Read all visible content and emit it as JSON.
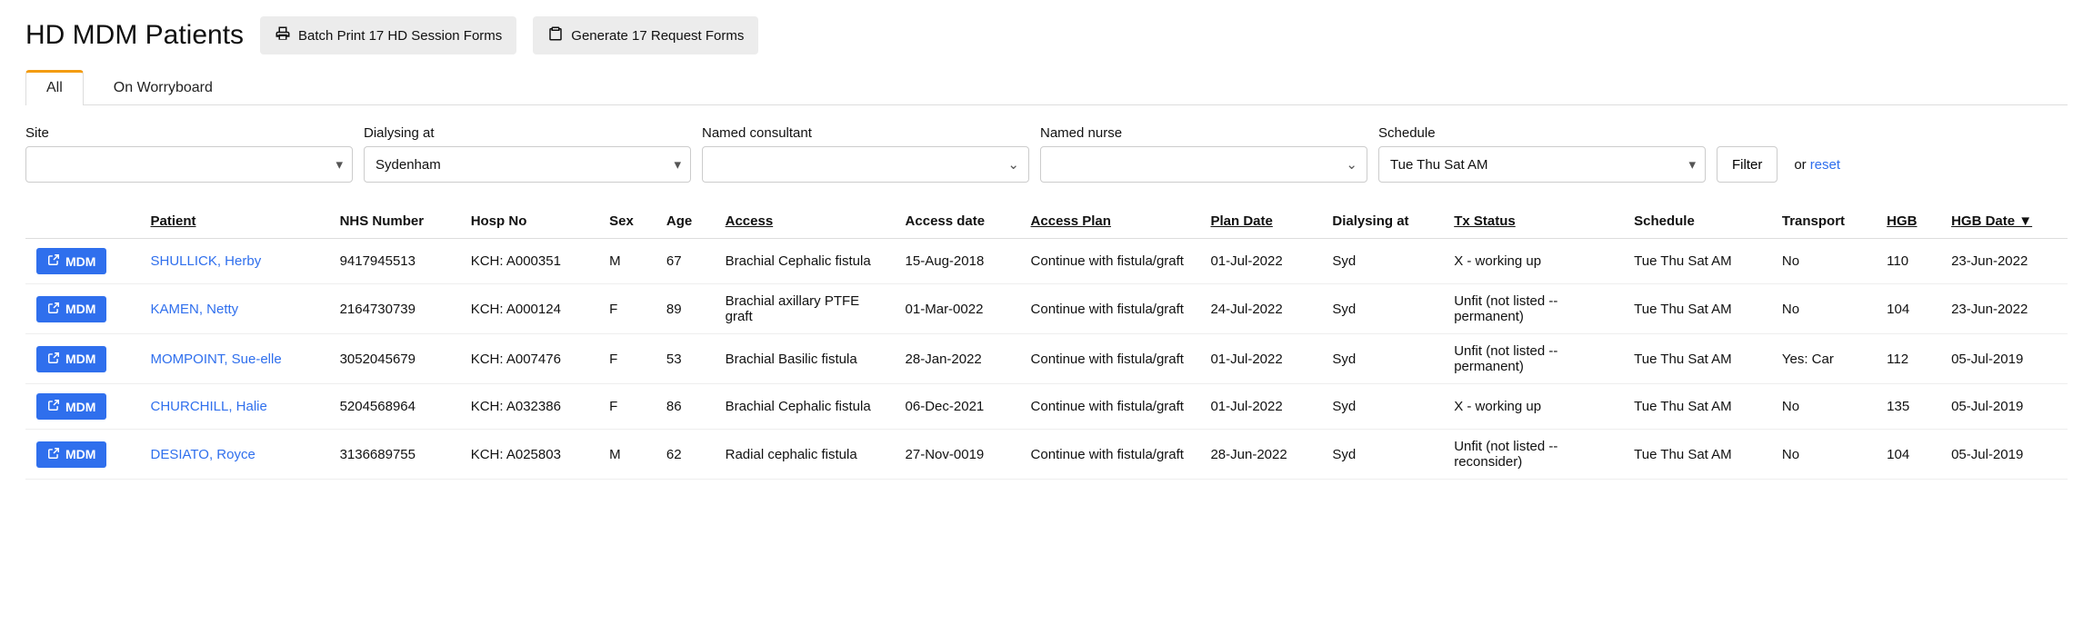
{
  "header": {
    "title": "HD MDM Patients",
    "batch_print_label": "Batch Print 17 HD Session Forms",
    "generate_label": "Generate 17 Request Forms"
  },
  "tabs": {
    "all": "All",
    "worry": "On Worryboard"
  },
  "filters": {
    "site_label": "Site",
    "site_value": "",
    "dialysing_label": "Dialysing at",
    "dialysing_value": "Sydenham",
    "consultant_label": "Named consultant",
    "consultant_value": "",
    "nurse_label": "Named nurse",
    "nurse_value": "",
    "schedule_label": "Schedule",
    "schedule_value": "Tue Thu Sat AM",
    "filter_button": "Filter",
    "or_text": "or",
    "reset_text": "reset"
  },
  "columns": {
    "mdm": "",
    "patient": "Patient",
    "nhs": "NHS Number",
    "hosp": "Hosp No",
    "sex": "Sex",
    "age": "Age",
    "access": "Access",
    "access_date": "Access date",
    "access_plan": "Access Plan",
    "plan_date": "Plan Date",
    "dialysing_at": "Dialysing at",
    "tx_status": "Tx Status",
    "schedule": "Schedule",
    "transport": "Transport",
    "hgb": "HGB",
    "hgb_date": "HGB Date ▼"
  },
  "mdm_button_label": "MDM",
  "rows": [
    {
      "patient": "SHULLICK, Herby",
      "nhs": "9417945513",
      "hosp": "KCH: A000351",
      "sex": "M",
      "age": "67",
      "access": "Brachial Cephalic fistula",
      "access_date": "15-Aug-2018",
      "access_plan": "Continue with fistula/graft",
      "plan_date": "01-Jul-2022",
      "dialysing_at": "Syd",
      "tx_status": "X - working up",
      "schedule": "Tue Thu Sat AM",
      "transport": "No",
      "hgb": "110",
      "hgb_date": "23-Jun-2022"
    },
    {
      "patient": "KAMEN, Netty",
      "nhs": "2164730739",
      "hosp": "KCH: A000124",
      "sex": "F",
      "age": "89",
      "access": "Brachial axillary PTFE graft",
      "access_date": "01-Mar-0022",
      "access_plan": "Continue with fistula/graft",
      "plan_date": "24-Jul-2022",
      "dialysing_at": "Syd",
      "tx_status": "Unfit (not listed -- permanent)",
      "schedule": "Tue Thu Sat AM",
      "transport": "No",
      "hgb": "104",
      "hgb_date": "23-Jun-2022"
    },
    {
      "patient": "MOMPOINT, Sue-elle",
      "nhs": "3052045679",
      "hosp": "KCH: A007476",
      "sex": "F",
      "age": "53",
      "access": "Brachial Basilic fistula",
      "access_date": "28-Jan-2022",
      "access_plan": "Continue with fistula/graft",
      "plan_date": "01-Jul-2022",
      "dialysing_at": "Syd",
      "tx_status": "Unfit (not listed -- permanent)",
      "schedule": "Tue Thu Sat AM",
      "transport": "Yes: Car",
      "hgb": "112",
      "hgb_date": "05-Jul-2019"
    },
    {
      "patient": "CHURCHILL, Halie",
      "nhs": "5204568964",
      "hosp": "KCH: A032386",
      "sex": "F",
      "age": "86",
      "access": "Brachial Cephalic fistula",
      "access_date": "06-Dec-2021",
      "access_plan": "Continue with fistula/graft",
      "plan_date": "01-Jul-2022",
      "dialysing_at": "Syd",
      "tx_status": "X - working up",
      "schedule": "Tue Thu Sat AM",
      "transport": "No",
      "hgb": "135",
      "hgb_date": "05-Jul-2019"
    },
    {
      "patient": "DESIATO, Royce",
      "nhs": "3136689755",
      "hosp": "KCH: A025803",
      "sex": "M",
      "age": "62",
      "access": "Radial cephalic fistula",
      "access_date": "27-Nov-0019",
      "access_plan": "Continue with fistula/graft",
      "plan_date": "28-Jun-2022",
      "dialysing_at": "Syd",
      "tx_status": "Unfit (not listed -- reconsider)",
      "schedule": "Tue Thu Sat AM",
      "transport": "No",
      "hgb": "104",
      "hgb_date": "05-Jul-2019"
    }
  ]
}
